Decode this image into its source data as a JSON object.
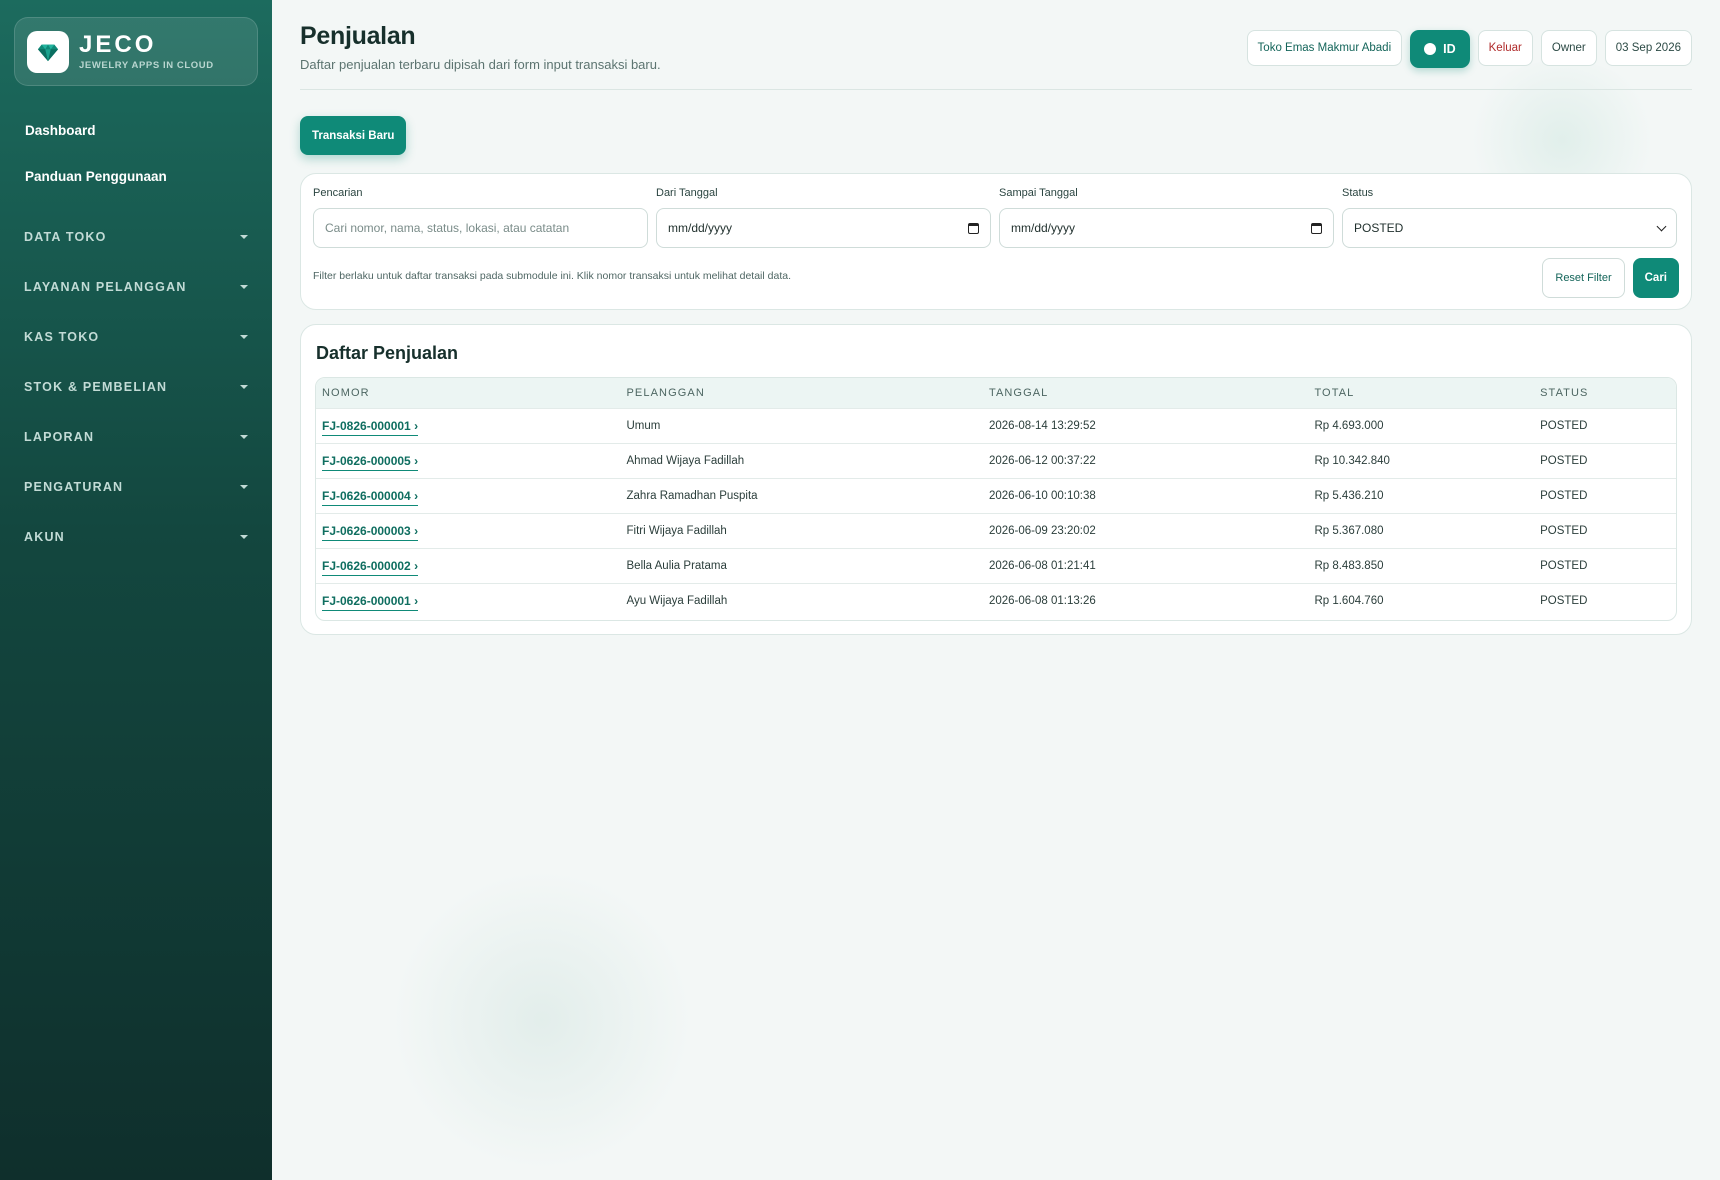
{
  "brand": {
    "name": "JECO",
    "tagline": "JEWELRY APPS IN CLOUD"
  },
  "sidebar": {
    "links": [
      "Dashboard",
      "Panduan Penggunaan"
    ],
    "sections": [
      "DATA TOKO",
      "LAYANAN PELANGGAN",
      "KAS TOKO",
      "STOK & PEMBELIAN",
      "LAPORAN",
      "PENGATURAN",
      "AKUN"
    ]
  },
  "header": {
    "title": "Penjualan",
    "subtitle": "Daftar penjualan terbaru dipisah dari form input transaksi baru.",
    "store": "Toko Emas Makmur Abadi",
    "language": "ID",
    "logout": "Keluar",
    "role": "Owner",
    "date": "03 Sep 2026"
  },
  "new_transaction_label": "Transaksi Baru",
  "filters": {
    "search": {
      "label": "Pencarian",
      "placeholder": "Cari nomor, nama, status, lokasi, atau catatan"
    },
    "from_date": {
      "label": "Dari Tanggal",
      "value": "mm/dd/yyyy"
    },
    "to_date": {
      "label": "Sampai Tanggal",
      "value": "mm/dd/yyyy"
    },
    "status": {
      "label": "Status",
      "value": "POSTED"
    },
    "note": "Filter berlaku untuk daftar transaksi pada submodule ini. Klik nomor transaksi untuk melihat detail data.",
    "reset_label": "Reset Filter",
    "search_label": "Cari"
  },
  "sales_list": {
    "title": "Daftar Penjualan",
    "columns": [
      "NOMOR",
      "PELANGGAN",
      "TANGGAL",
      "TOTAL",
      "STATUS"
    ],
    "rows": [
      {
        "number": "FJ-0826-000001 ›",
        "customer": "Umum",
        "date": "2026-08-14 13:29:52",
        "total": "Rp 4.693.000",
        "status": "POSTED"
      },
      {
        "number": "FJ-0626-000005 ›",
        "customer": "Ahmad Wijaya Fadillah",
        "date": "2026-06-12 00:37:22",
        "total": "Rp 10.342.840",
        "status": "POSTED"
      },
      {
        "number": "FJ-0626-000004 ›",
        "customer": "Zahra Ramadhan Puspita",
        "date": "2026-06-10 00:10:38",
        "total": "Rp 5.436.210",
        "status": "POSTED"
      },
      {
        "number": "FJ-0626-000003 ›",
        "customer": "Fitri Wijaya Fadillah",
        "date": "2026-06-09 23:20:02",
        "total": "Rp 5.367.080",
        "status": "POSTED"
      },
      {
        "number": "FJ-0626-000002 ›",
        "customer": "Bella Aulia Pratama",
        "date": "2026-06-08 01:21:41",
        "total": "Rp 8.483.850",
        "status": "POSTED"
      },
      {
        "number": "FJ-0626-000001 ›",
        "customer": "Ayu Wijaya Fadillah",
        "date": "2026-06-08 01:13:26",
        "total": "Rp 1.604.760",
        "status": "POSTED"
      }
    ]
  },
  "colors": {
    "primary": "#0f8a78",
    "sidebar": "#13473f",
    "danger": "#b02b2b"
  }
}
